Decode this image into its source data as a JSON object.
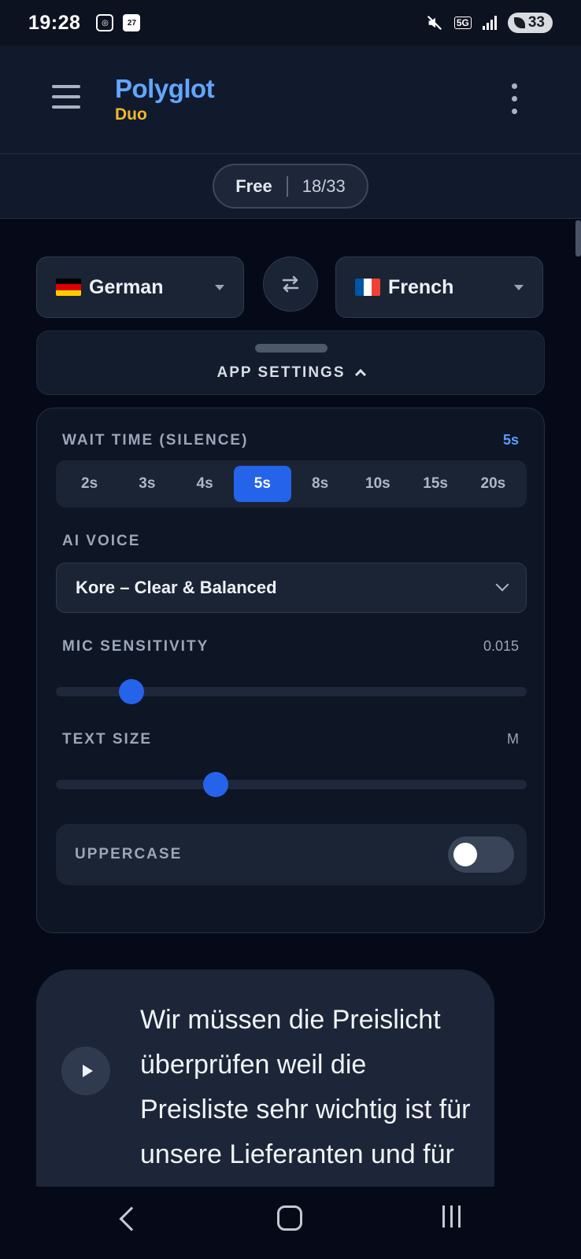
{
  "status_bar": {
    "time": "19:28",
    "calendar_date": "27",
    "network": "5G",
    "battery": "33"
  },
  "app": {
    "title": "Polyglot",
    "subtitle": "Duo"
  },
  "plan": {
    "tier": "Free",
    "usage": "18/33"
  },
  "languages": {
    "source": {
      "flag": "germany-flag-icon",
      "label": "German"
    },
    "target": {
      "flag": "france-flag-icon",
      "label": "French"
    }
  },
  "settings": {
    "toggle_label": "APP SETTINGS",
    "wait_time": {
      "label": "WAIT TIME (SILENCE)",
      "value": "5s",
      "options": [
        "2s",
        "3s",
        "4s",
        "5s",
        "8s",
        "10s",
        "15s",
        "20s"
      ],
      "selected": "5s"
    },
    "ai_voice": {
      "label": "AI VOICE",
      "value": "Kore – Clear & Balanced"
    },
    "mic_sensitivity": {
      "label": "MIC SENSITIVITY",
      "value": "0.015",
      "level_fraction": 0.16
    },
    "text_size": {
      "label": "TEXT SIZE",
      "value": "M",
      "level_fraction": 0.34
    },
    "uppercase": {
      "label": "UPPERCASE",
      "enabled": false
    }
  },
  "transcript": {
    "text": "Wir müssen die Preislicht überprüfen weil die Preisliste sehr wichtig ist für unsere Lieferanten und für"
  },
  "colors": {
    "accent": "#2563eb",
    "brand_blue": "#62a6ff",
    "brand_yellow": "#f1b92b",
    "background": "#060a18"
  }
}
